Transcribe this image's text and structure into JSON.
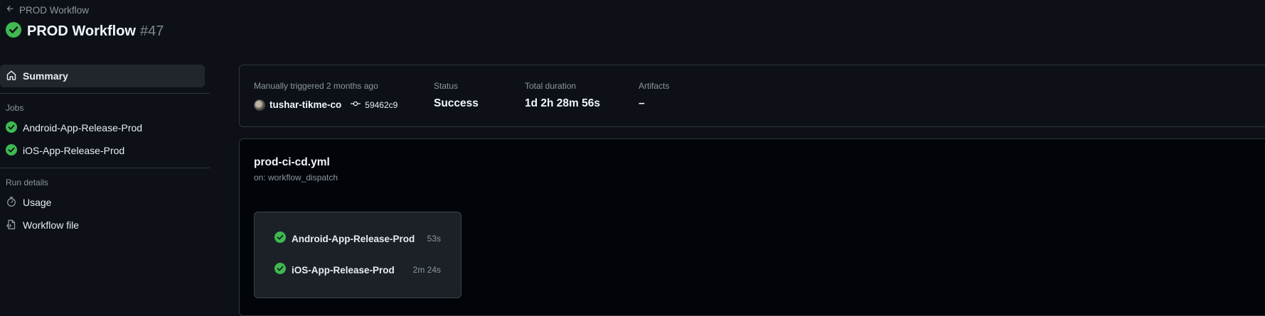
{
  "header": {
    "back_label": "PROD Workflow",
    "title": "PROD Workflow",
    "run_number": "#47"
  },
  "sidebar": {
    "summary_label": "Summary",
    "jobs_heading": "Jobs",
    "jobs": [
      {
        "label": "Android-App-Release-Prod"
      },
      {
        "label": "iOS-App-Release-Prod"
      }
    ],
    "run_details_heading": "Run details",
    "usage_label": "Usage",
    "workflow_file_label": "Workflow file"
  },
  "summary": {
    "trigger_text": "Manually triggered 2 months ago",
    "actor": "tushar-tikme-co",
    "commit_sha": "59462c9",
    "status_label": "Status",
    "status_value": "Success",
    "duration_label": "Total duration",
    "duration_value": "1d 2h 28m 56s",
    "artifacts_label": "Artifacts",
    "artifacts_value": "–"
  },
  "graph": {
    "workflow_file": "prod-ci-cd.yml",
    "trigger": "on: workflow_dispatch",
    "jobs": [
      {
        "name": "Android-App-Release-Prod",
        "duration": "53s"
      },
      {
        "name": "iOS-App-Release-Prod",
        "duration": "2m 24s"
      }
    ]
  },
  "colors": {
    "background": "#0d1117",
    "success": "#3fb950",
    "border": "#30363d"
  }
}
